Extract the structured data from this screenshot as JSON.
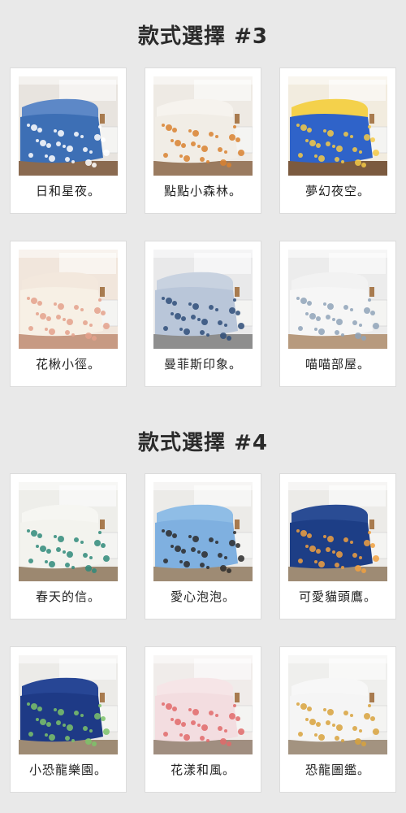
{
  "sections": [
    {
      "title": "款式選擇 #3",
      "items": [
        {
          "label": "日和星夜。",
          "scene": "blue-stars"
        },
        {
          "label": "點點小森林。",
          "scene": "beige-trees"
        },
        {
          "label": "夢幻夜空。",
          "scene": "yellow-blue"
        },
        {
          "label": "花楸小徑。",
          "scene": "dotted-cream"
        },
        {
          "label": "曼菲斯印象。",
          "scene": "triangles"
        },
        {
          "label": "喵喵部屋。",
          "scene": "cats-white"
        }
      ]
    },
    {
      "title": "款式選擇 #4",
      "items": [
        {
          "label": "春天的信。",
          "scene": "leaves"
        },
        {
          "label": "愛心泡泡。",
          "scene": "hearts-blue"
        },
        {
          "label": "可愛貓頭鷹。",
          "scene": "owls-navy"
        },
        {
          "label": "小恐龍樂園。",
          "scene": "dino-navy"
        },
        {
          "label": "花漾和風。",
          "scene": "floral-pink"
        },
        {
          "label": "恐龍圖鑑。",
          "scene": "dino-white"
        }
      ]
    }
  ],
  "colors": {
    "background": "#e9e9e9",
    "card": "#ffffff",
    "title": "#2b2b2b"
  }
}
